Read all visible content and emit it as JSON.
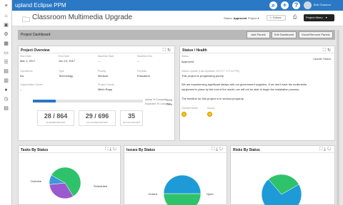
{
  "app": {
    "logo_text": "upland Eclipse PPM"
  },
  "user": {
    "name": "Bob Graunon"
  },
  "project": {
    "title": "Classroom Multimedia Upgrade",
    "status_label": "Status:",
    "status_value": "Approved",
    "phase_label": "Project ▾",
    "follow_label": "☆ Follow",
    "menu_label": "Project Menu"
  },
  "dashboard": {
    "title": "Project Dashboard",
    "add_panels": "Add Panels",
    "edit_dashboard": "Edit Dashboard",
    "move_remove": "Move/Remove Panels"
  },
  "overview": {
    "title": "Project Overview",
    "fields": [
      {
        "label": "Start Date",
        "value": "Mar 1, 2017"
      },
      {
        "label": "End Date",
        "value": "Jun 13, 2017"
      },
      {
        "label": "Baseline Start",
        "value": "--"
      },
      {
        "label": "Baseline End",
        "value": "--"
      },
      {
        "label": "Operations",
        "value": "No"
      },
      {
        "label": "Type",
        "value": "Technology"
      },
      {
        "label": "Priority",
        "value": "Medium"
      },
      {
        "label": "Portfolio",
        "value": "Education"
      },
      {
        "label": "Organization Owner",
        "value": "--"
      },
      {
        "label": "Project Owner",
        "value": "Mitch Rapp"
      }
    ],
    "actual_pct_label": "Actual % Complete",
    "actual_pct_value": "21%",
    "expected_pct_label": "Expected % Complete",
    "expected_pct_value": "74%",
    "progress_fraction": 0.21,
    "kpis": [
      {
        "value": "28 / 864",
        "caption": "PLANNED EFFORT"
      },
      {
        "value": "29 / 696",
        "caption": "ALLOCATED EFFORT"
      },
      {
        "value": "35",
        "caption": "ACTUAL EFFORT"
      }
    ]
  },
  "status_health": {
    "title": "Status / Health",
    "status_label": "Status",
    "status_value": "Approved",
    "update_link": "Update Status",
    "updated_line": "Status Update (Last Updated: 3/27/17 7:27:42 PM)",
    "line1": "This project is progressing poorly.",
    "line2": "We are experiencing significant delays with our government suppliers.  If we don't have the multimedia",
    "line3": "equipment in place by the end of the month, we will not be able to begin the installation process.",
    "line4": "The timeline for this project is in serious jeopardy.",
    "overall_label": "Overall Health",
    "issues_label": "Issues"
  },
  "tasks_panel": {
    "title": "Tasks By Status",
    "labels": [
      "Overdue",
      "Scheduled"
    ]
  },
  "issues_panel": {
    "title": "Issues By Status",
    "labels": [
      "Closed",
      "Open"
    ]
  },
  "risks_panel": {
    "title": "Risks By Status"
  },
  "chart_data": [
    {
      "type": "pie",
      "title": "Tasks By Status",
      "categories": [
        "Scheduled",
        "Overdue",
        "Other"
      ],
      "values": [
        58,
        32,
        10
      ],
      "colors": [
        "#2ec26a",
        "#9b59d0",
        "#3a9ad9"
      ]
    },
    {
      "type": "pie",
      "title": "Issues By Status",
      "categories": [
        "Open",
        "Closed"
      ],
      "values": [
        50,
        50
      ],
      "colors": [
        "#2ec26a",
        "#1e9bd7"
      ]
    },
    {
      "type": "pie",
      "title": "Risks By Status",
      "categories": [
        "",
        ""
      ],
      "values": [
        72,
        28
      ],
      "colors": [
        "#1e9bd7",
        "#2ec26a"
      ]
    }
  ],
  "colors": {
    "brand": "#2b78c5",
    "progress": "#2b78c5"
  }
}
